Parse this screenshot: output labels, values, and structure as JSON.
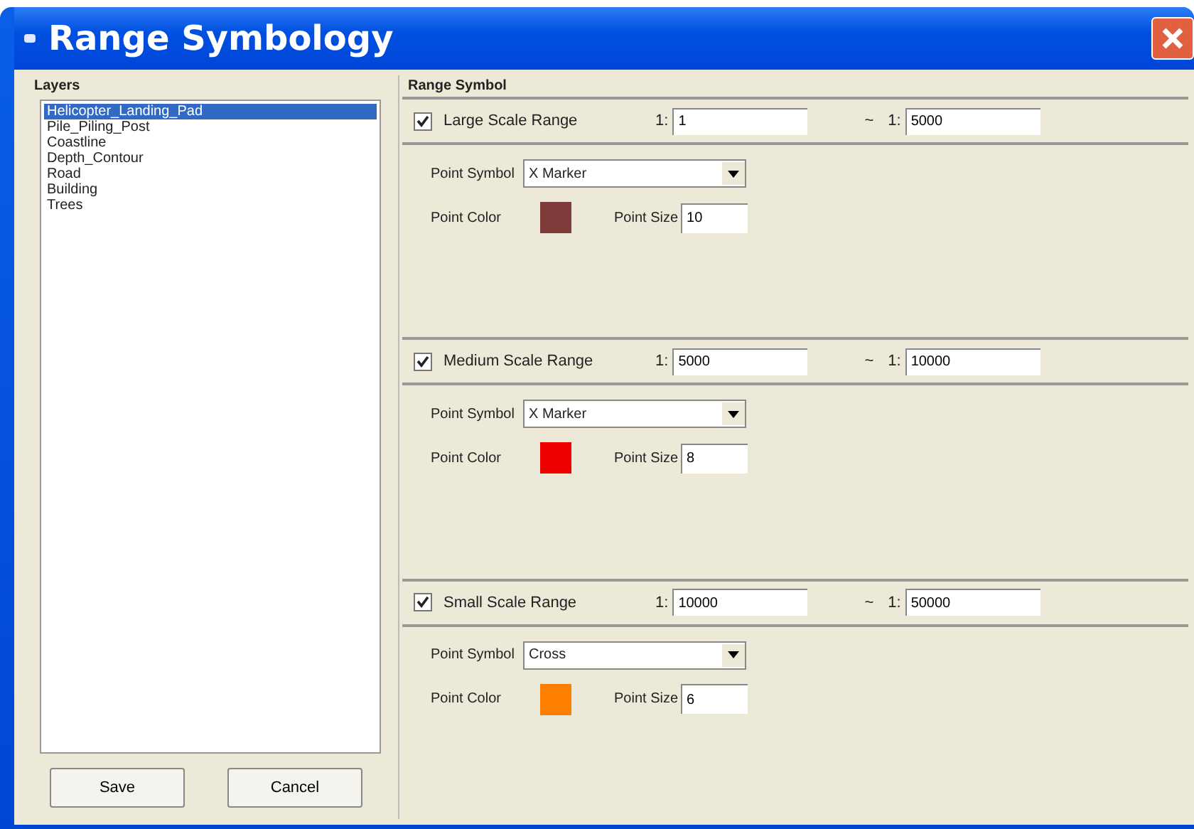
{
  "window": {
    "title": "Range Symbology"
  },
  "layers": {
    "label": "Layers",
    "items": [
      {
        "name": "Helicopter_Landing_Pad",
        "selected": true
      },
      {
        "name": "Pile_Piling_Post",
        "selected": false
      },
      {
        "name": "Coastline",
        "selected": false
      },
      {
        "name": "Depth_Contour",
        "selected": false
      },
      {
        "name": "Road",
        "selected": false
      },
      {
        "name": "Building",
        "selected": false
      },
      {
        "name": "Trees",
        "selected": false
      }
    ]
  },
  "buttons": [
    "Save",
    "Cancel"
  ],
  "range_symbol": {
    "label": "Range Symbol",
    "ranges": [
      {
        "label": "Large Scale Range",
        "checked": true,
        "from_prefix": "1:",
        "from": "1",
        "separator": "~",
        "to_prefix": "1:",
        "to": "5000",
        "symbol_label": "Point Symbol",
        "symbol": "X Marker",
        "color_label": "Point Color",
        "color": "#7f3a3a",
        "size_label": "Point Size",
        "size": "10"
      },
      {
        "label": "Medium Scale Range",
        "checked": true,
        "from_prefix": "1:",
        "from": "5000",
        "separator": "~",
        "to_prefix": "1:",
        "to": "10000",
        "symbol_label": "Point Symbol",
        "symbol": "X Marker",
        "color_label": "Point Color",
        "color": "#ee0000",
        "size_label": "Point Size",
        "size": "8"
      },
      {
        "label": "Small Scale Range",
        "checked": true,
        "from_prefix": "1:",
        "from": "10000",
        "separator": "~",
        "to_prefix": "1:",
        "to": "50000",
        "symbol_label": "Point Symbol",
        "symbol": "Cross",
        "color_label": "Point Color",
        "color": "#ff8000",
        "size_label": "Point Size",
        "size": "6"
      }
    ]
  }
}
